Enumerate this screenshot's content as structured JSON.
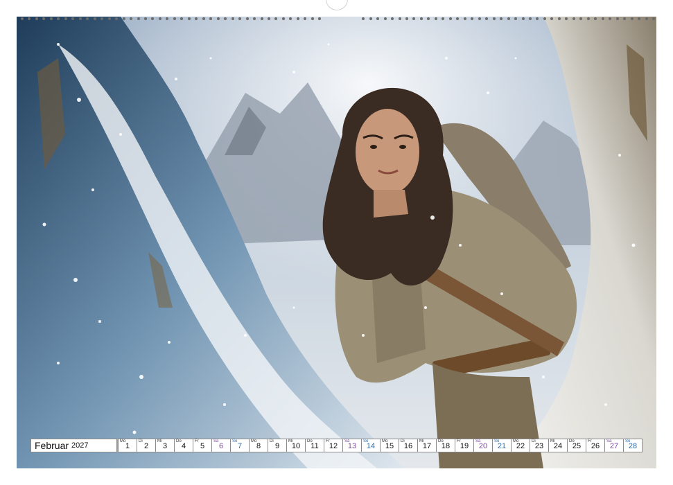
{
  "calendar": {
    "month": "Februar",
    "year": "2027",
    "days": [
      {
        "wd": "Mo",
        "n": "1",
        "t": "wk"
      },
      {
        "wd": "Di",
        "n": "2",
        "t": "wk"
      },
      {
        "wd": "Mi",
        "n": "3",
        "t": "wk"
      },
      {
        "wd": "Do",
        "n": "4",
        "t": "wk"
      },
      {
        "wd": "Fr",
        "n": "5",
        "t": "wk"
      },
      {
        "wd": "Sa",
        "n": "6",
        "t": "sat"
      },
      {
        "wd": "So",
        "n": "7",
        "t": "sun"
      },
      {
        "wd": "Mo",
        "n": "8",
        "t": "wk"
      },
      {
        "wd": "Di",
        "n": "9",
        "t": "wk"
      },
      {
        "wd": "Mi",
        "n": "10",
        "t": "wk"
      },
      {
        "wd": "Do",
        "n": "11",
        "t": "wk"
      },
      {
        "wd": "Fr",
        "n": "12",
        "t": "wk"
      },
      {
        "wd": "Sa",
        "n": "13",
        "t": "sat"
      },
      {
        "wd": "So",
        "n": "14",
        "t": "sun"
      },
      {
        "wd": "Mo",
        "n": "15",
        "t": "wk"
      },
      {
        "wd": "Di",
        "n": "16",
        "t": "wk"
      },
      {
        "wd": "Mi",
        "n": "17",
        "t": "wk"
      },
      {
        "wd": "Do",
        "n": "18",
        "t": "wk"
      },
      {
        "wd": "Fr",
        "n": "19",
        "t": "wk"
      },
      {
        "wd": "Sa",
        "n": "20",
        "t": "sat"
      },
      {
        "wd": "So",
        "n": "21",
        "t": "sun"
      },
      {
        "wd": "Mo",
        "n": "22",
        "t": "wk"
      },
      {
        "wd": "Di",
        "n": "23",
        "t": "wk"
      },
      {
        "wd": "Mi",
        "n": "24",
        "t": "wk"
      },
      {
        "wd": "Do",
        "n": "25",
        "t": "wk"
      },
      {
        "wd": "Fr",
        "n": "26",
        "t": "wk"
      },
      {
        "wd": "Sa",
        "n": "27",
        "t": "sat"
      },
      {
        "wd": "So",
        "n": "28",
        "t": "sun"
      }
    ]
  },
  "colors": {
    "saturday": "#7b4a9c",
    "sunday": "#2a6fb3"
  }
}
